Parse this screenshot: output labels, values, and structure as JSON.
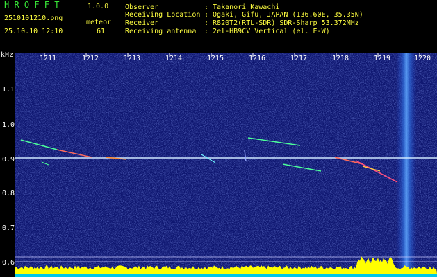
{
  "app": {
    "title": "H R O F F T",
    "version": "1.0.0"
  },
  "file": {
    "filename": "2510101210.png",
    "datetime": "25.10.10 12:10"
  },
  "meteor": {
    "label": "meteor",
    "count": "61"
  },
  "station": {
    "observer_label": "Observer",
    "observer_value": ": Takanori Kawachi",
    "location_label": "Receiving Location",
    "location_value": ": Ogaki, Gifu, JAPAN (136.60E, 35.35N)",
    "receiver_label": "Receiver",
    "receiver_value": ": R820T2(RTL-SDR) SDR-Sharp 53.372MHz",
    "antenna_label": "Receiving antenna",
    "antenna_value": ": 2el-HB9CV Vertical (el. E-W)"
  },
  "axes": {
    "y_unit": "kHz",
    "y_ticks": [
      "1.1",
      "1.0",
      "0.9",
      "0.8",
      "0.7",
      "0.6"
    ],
    "x_ticks": [
      "1211",
      "1212",
      "1213",
      "1214",
      "1215",
      "1216",
      "1217",
      "1218",
      "1219",
      "1220"
    ]
  },
  "colors": {
    "background": "#000000",
    "spectrum_bg": "#101a78",
    "title_green": "#38e838",
    "text_yellow": "#ffff40",
    "carrier": "#c8e8ff",
    "amplitude_fill": "#ffff00",
    "amplitude_base": "#00c8e8"
  }
}
